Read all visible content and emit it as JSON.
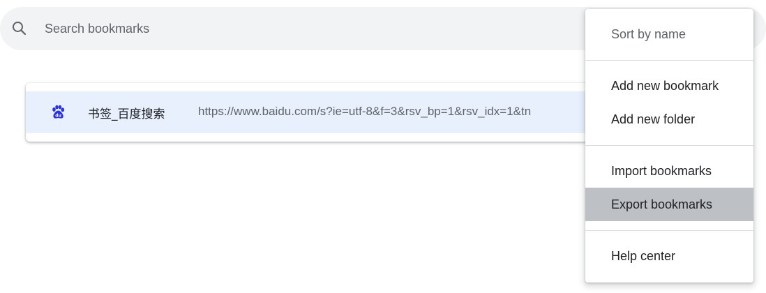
{
  "search": {
    "placeholder": "Search bookmarks",
    "icon": "search-icon"
  },
  "bookmarks": [
    {
      "title": "书签_百度搜索",
      "url": "https://www.baidu.com/s?ie=utf-8&f=3&rsv_bp=1&rsv_idx=1&tn",
      "favicon": "baidu-paw-icon"
    }
  ],
  "menu": {
    "items": [
      {
        "label": "Sort by name",
        "state": "disabled"
      },
      {
        "label": "Add new bookmark"
      },
      {
        "label": "Add new folder"
      },
      {
        "label": "Import bookmarks"
      },
      {
        "label": "Export bookmarks",
        "state": "highlighted"
      },
      {
        "label": "Help center"
      }
    ]
  },
  "colors": {
    "search_bg": "#f1f3f4",
    "selected_row": "#e8f0fe",
    "menu_highlight": "#bdc1c6",
    "favicon_blue": "#2932e1"
  }
}
